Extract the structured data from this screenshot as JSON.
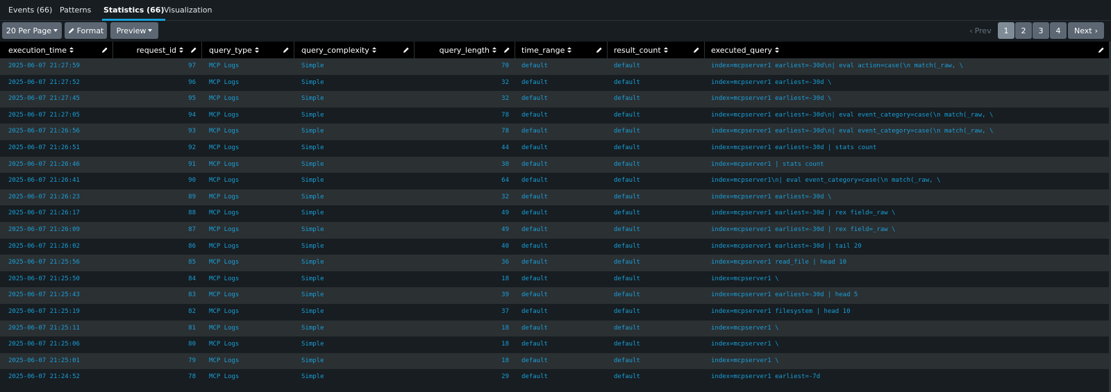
{
  "tabs": [
    {
      "label": "Events (66)"
    },
    {
      "label": "Patterns"
    },
    {
      "label": "Statistics (66)"
    },
    {
      "label": "Visualization"
    }
  ],
  "toolbar": {
    "per_page_label": "20 Per Page",
    "format_label": "Format",
    "preview_label": "Preview"
  },
  "pager": {
    "prev_label": "Prev",
    "pages": [
      "1",
      "2",
      "3",
      "4"
    ],
    "current_page": "1",
    "next_label": "Next"
  },
  "columns": [
    "execution_time",
    "request_id",
    "query_type",
    "query_complexity",
    "query_length",
    "time_range",
    "result_count",
    "executed_query"
  ],
  "rows": [
    [
      "2025-06-07 21:27:59",
      "97",
      "MCP Logs",
      "Simple",
      "70",
      "default",
      "default",
      "index=mcpserver1 earliest=-30d\\n| eval action=case(\\n    match(_raw, \\"
    ],
    [
      "2025-06-07 21:27:52",
      "96",
      "MCP Logs",
      "Simple",
      "32",
      "default",
      "default",
      "index=mcpserver1 earliest=-30d \\"
    ],
    [
      "2025-06-07 21:27:45",
      "95",
      "MCP Logs",
      "Simple",
      "32",
      "default",
      "default",
      "index=mcpserver1 earliest=-30d \\"
    ],
    [
      "2025-06-07 21:27:05",
      "94",
      "MCP Logs",
      "Simple",
      "78",
      "default",
      "default",
      "index=mcpserver1 earliest=-30d\\n| eval event_category=case(\\n    match(_raw, \\"
    ],
    [
      "2025-06-07 21:26:56",
      "93",
      "MCP Logs",
      "Simple",
      "78",
      "default",
      "default",
      "index=mcpserver1 earliest=-30d\\n| eval event_category=case(\\n    match(_raw, \\"
    ],
    [
      "2025-06-07 21:26:51",
      "92",
      "MCP Logs",
      "Simple",
      "44",
      "default",
      "default",
      "index=mcpserver1 earliest=-30d | stats count"
    ],
    [
      "2025-06-07 21:26:46",
      "91",
      "MCP Logs",
      "Simple",
      "30",
      "default",
      "default",
      "index=mcpserver1 | stats count"
    ],
    [
      "2025-06-07 21:26:41",
      "90",
      "MCP Logs",
      "Simple",
      "64",
      "default",
      "default",
      "index=mcpserver1\\n| eval event_category=case(\\n    match(_raw, \\"
    ],
    [
      "2025-06-07 21:26:23",
      "89",
      "MCP Logs",
      "Simple",
      "32",
      "default",
      "default",
      "index=mcpserver1 earliest=-30d \\"
    ],
    [
      "2025-06-07 21:26:17",
      "88",
      "MCP Logs",
      "Simple",
      "49",
      "default",
      "default",
      "index=mcpserver1 earliest=-30d | rex field=_raw \\"
    ],
    [
      "2025-06-07 21:26:09",
      "87",
      "MCP Logs",
      "Simple",
      "49",
      "default",
      "default",
      "index=mcpserver1 earliest=-30d | rex field=_raw \\"
    ],
    [
      "2025-06-07 21:26:02",
      "86",
      "MCP Logs",
      "Simple",
      "40",
      "default",
      "default",
      "index=mcpserver1 earliest=-30d | tail 20"
    ],
    [
      "2025-06-07 21:25:56",
      "85",
      "MCP Logs",
      "Simple",
      "36",
      "default",
      "default",
      "index=mcpserver1 read_file | head 10"
    ],
    [
      "2025-06-07 21:25:50",
      "84",
      "MCP Logs",
      "Simple",
      "18",
      "default",
      "default",
      "index=mcpserver1 \\"
    ],
    [
      "2025-06-07 21:25:43",
      "83",
      "MCP Logs",
      "Simple",
      "39",
      "default",
      "default",
      "index=mcpserver1 earliest=-30d | head 5"
    ],
    [
      "2025-06-07 21:25:19",
      "82",
      "MCP Logs",
      "Simple",
      "37",
      "default",
      "default",
      "index=mcpserver1 filesystem | head 10"
    ],
    [
      "2025-06-07 21:25:11",
      "81",
      "MCP Logs",
      "Simple",
      "18",
      "default",
      "default",
      "index=mcpserver1 \\"
    ],
    [
      "2025-06-07 21:25:06",
      "80",
      "MCP Logs",
      "Simple",
      "18",
      "default",
      "default",
      "index=mcpserver1 \\"
    ],
    [
      "2025-06-07 21:25:01",
      "79",
      "MCP Logs",
      "Simple",
      "18",
      "default",
      "default",
      "index=mcpserver1 \\"
    ],
    [
      "2025-06-07 21:24:52",
      "78",
      "MCP Logs",
      "Simple",
      "29",
      "default",
      "default",
      "index=mcpserver1 earliest=-7d"
    ]
  ],
  "colors": {
    "accent": "#1a9fd8",
    "row_stripe": "#2b3033",
    "background": "#171d21",
    "button": "#5c6773"
  }
}
